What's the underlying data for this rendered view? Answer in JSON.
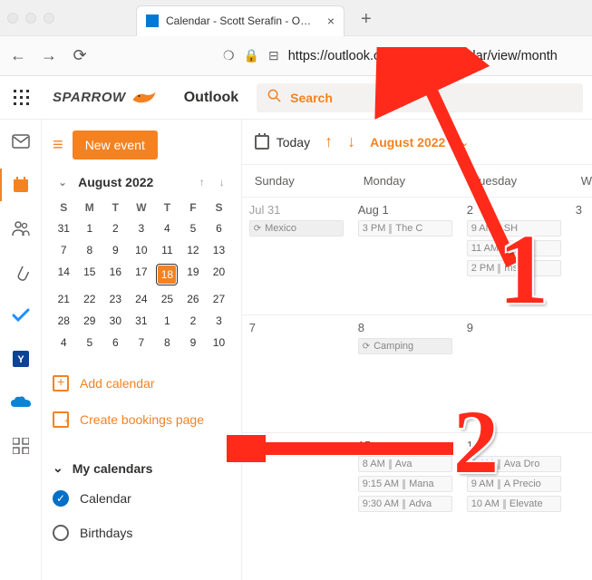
{
  "browser": {
    "tab_title": "Calendar - Scott Serafin - Outlo",
    "url": "https://outlook.office.com/calendar/view/month"
  },
  "header": {
    "brand": "SPARROW",
    "app_name": "Outlook",
    "search_placeholder": "Search"
  },
  "sidebar": {
    "new_event": "New event",
    "mini_title": "August 2022",
    "dows": [
      "S",
      "M",
      "T",
      "W",
      "T",
      "F",
      "S"
    ],
    "days": [
      "31",
      "1",
      "2",
      "3",
      "4",
      "5",
      "6",
      "7",
      "8",
      "9",
      "10",
      "11",
      "12",
      "13",
      "14",
      "15",
      "16",
      "17",
      "18",
      "19",
      "20",
      "21",
      "22",
      "23",
      "24",
      "25",
      "26",
      "27",
      "28",
      "29",
      "30",
      "31",
      "1",
      "2",
      "3",
      "4",
      "5",
      "6",
      "7",
      "8",
      "9",
      "10"
    ],
    "add_calendar": "Add calendar",
    "create_bookings": "Create bookings page",
    "my_calendars": "My calendars",
    "items": [
      {
        "label": "Calendar",
        "checked": true
      },
      {
        "label": "Birthdays",
        "checked": false
      }
    ]
  },
  "toolbar": {
    "today": "Today",
    "month": "August 2022"
  },
  "month": {
    "dows": [
      "Sunday",
      "Monday",
      "Tuesday",
      "W"
    ],
    "rows": [
      {
        "days": [
          {
            "num": "Jul 31",
            "dim": true,
            "events": [
              {
                "kind": "span",
                "label": "Mexico"
              }
            ]
          },
          {
            "num": "Aug 1",
            "events": [
              {
                "time": "3 PM",
                "label": "The C"
              }
            ]
          },
          {
            "num": "2",
            "events": [
              {
                "time": "9 AM",
                "label": "SH"
              },
              {
                "time": "11 AM",
                "label": "bin"
              },
              {
                "time": "2 PM",
                "label": "ms"
              }
            ]
          },
          {
            "num": "3"
          }
        ]
      },
      {
        "days": [
          {
            "num": "7"
          },
          {
            "num": "8",
            "events": [
              {
                "kind": "span",
                "label": "Camping"
              }
            ]
          },
          {
            "num": "9"
          },
          {
            "num": ""
          }
        ]
      },
      {
        "days": [
          {
            "num": "14"
          },
          {
            "num": "15",
            "events": [
              {
                "time": "8 AM",
                "label": "Ava"
              },
              {
                "time": "9:15 AM",
                "label": "Mana"
              },
              {
                "time": "9:30 AM",
                "label": "Adva"
              }
            ]
          },
          {
            "num": "16",
            "events": [
              {
                "time": "8 AM",
                "label": "Ava Dro"
              },
              {
                "time": "9 AM",
                "label": "A Precio"
              },
              {
                "time": "10 AM",
                "label": "Elevate"
              }
            ]
          },
          {
            "num": ""
          }
        ]
      }
    ]
  },
  "annotations": {
    "one": "1",
    "two": "2"
  }
}
